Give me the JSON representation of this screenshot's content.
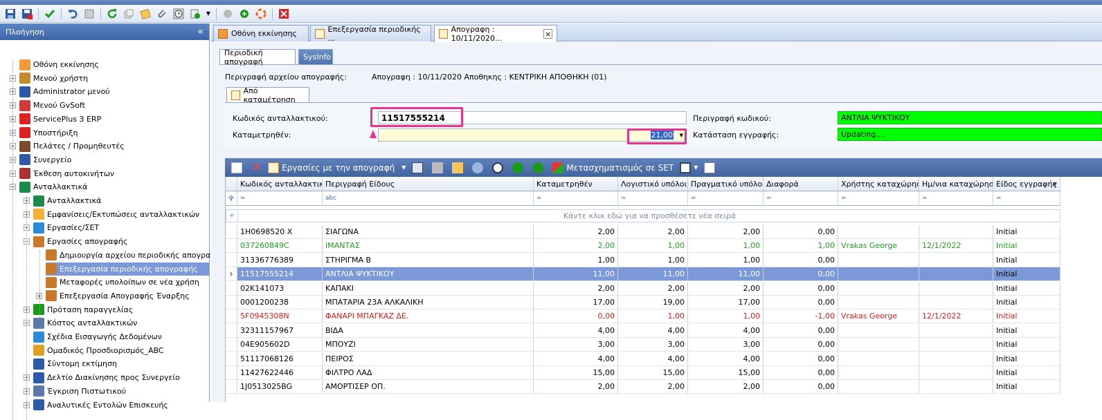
{
  "toolbar": {
    "icons": [
      "save-icon",
      "save-close-icon",
      "check-icon",
      "undo-icon",
      "list-icon",
      "refresh-icon",
      "copy-icon",
      "notes-icon",
      "attach-icon",
      "clock-icon",
      "export-icon",
      "dropdown-icon",
      "disabled-circle-icon",
      "green-circle-icon",
      "help-ring-icon",
      "close-red-icon"
    ]
  },
  "nav": {
    "title": "Πλοήγηση",
    "collapse": "«",
    "items": [
      {
        "label": "Οθόνη εκκίνησης",
        "level": 1
      },
      {
        "label": "Μενού χρήστη",
        "level": 1
      },
      {
        "label": "Administrator μενού",
        "level": 1
      },
      {
        "label": "Μενού GvSoft",
        "level": 1
      },
      {
        "label": "ServicePlus 3 ERP",
        "level": 1
      },
      {
        "label": "Υποστήριξη",
        "level": 1
      },
      {
        "label": "Πελάτες / Προμηθευτές",
        "level": 1
      },
      {
        "label": "Συνεργείο",
        "level": 1
      },
      {
        "label": "Έκθεση αυτοκινήτων",
        "level": 1
      },
      {
        "label": "Ανταλλακτικά",
        "level": 1
      },
      {
        "label": "Ανταλλακτικά",
        "level": 2
      },
      {
        "label": "Εμφανίσεις/Εκτυπώσεις ανταλλακτικών",
        "level": 2
      },
      {
        "label": "Εργασίες/ΣΕΤ",
        "level": 2
      },
      {
        "label": "Εργασίες απογραφής",
        "level": 2
      },
      {
        "label": "Δημιουργία αρχείου περιοδικής απογραφής",
        "level": 3
      },
      {
        "label": "Επεξεργασία περιοδικής απογραφής",
        "level": 3
      },
      {
        "label": "Μεταφορές υπολοίπων σε νέα χρήση",
        "level": 3
      },
      {
        "label": "Επεξεργασία Απογραφής Έναρξης",
        "level": 3
      },
      {
        "label": "Πρόταση παραγγελίας",
        "level": 2
      },
      {
        "label": "Κόστος ανταλλακτικών",
        "level": 2
      },
      {
        "label": "Σχέδια Εισαγωγής Δεδομένων",
        "level": 2
      },
      {
        "label": "Ομαδικός Προσδιορισμός_ABC",
        "level": 2
      },
      {
        "label": "Σύντομη εκτίμηση",
        "level": 2
      },
      {
        "label": "Δελτίο Διακίνησης προς Συνεργείο",
        "level": 2
      },
      {
        "label": "Έγκριση Πιστωτικού",
        "level": 2
      },
      {
        "label": "Αναλυτικές Εντολών Επισκευής",
        "level": 2
      }
    ]
  },
  "tabs": [
    {
      "label": "Οθόνη εκκίνησης"
    },
    {
      "label": "Επεξεργασία περιοδικής ..."
    },
    {
      "label": "Απογραφη : 10/11/2020..."
    }
  ],
  "tab_close": "×",
  "subtabs": [
    "Περιοδική απογραφή",
    "SysInfo"
  ],
  "form": {
    "file_desc_label": "Περιγραφή αρχείου απογραφής:",
    "file_desc_value": "Απογραφη : 10/11/2020   Αποθηκης : ΚΕΝΤΡΙΚΗ ΑΠΟΘΗΚΗ (01)",
    "group_title": "Από καταμέτρηση",
    "code_label": "Κωδικός ανταλλακτικού:",
    "code_value": "11517555214",
    "counted_label": "Καταμετρηθέν:",
    "counted_value": "21,00",
    "code_desc_label": "Περιγραφή κωδικού:",
    "code_desc_value": "ΑΝΤΛΙΑ ΨΥΚΤΙΚΟΥ",
    "status_label": "Κατάσταση εγγραφής:",
    "status_value": "Updating....",
    "green": "#00ff00"
  },
  "gridtoolbar": {
    "jobs": "Εργασίες με την απογραφή",
    "transform": "Μετασχηματισμός σε SET"
  },
  "grid": {
    "columns": [
      "Κωδικός ανταλλακτικού",
      "Περιγραφή Είδους",
      "Καταμετρηθέν",
      "Λογιστικό υπόλοιπο",
      "Πραγματικό υπόλοιπο",
      "Διαφορά",
      "Χρήστης καταχώρησης",
      "Ημ/νια καταχώρησης",
      "Είδος εγγραφής"
    ],
    "filter_eq": "=",
    "filter_abc": "abc",
    "newrow": "Κάντε κλικ εδώ για να προσθέσετε νέα σειρά",
    "rows": [
      {
        "code": "1H0698520 X",
        "desc": "ΣΙΑΓΩΝΑ",
        "counted": "2,00",
        "acc": "2,00",
        "real": "2,00",
        "diff": "0,00",
        "user": "",
        "date": "",
        "type": "Initial",
        "style": ""
      },
      {
        "code": "037260849C",
        "desc": "ΙΜΑΝΤΑΣ",
        "counted": "2,00",
        "acc": "1,00",
        "real": "1,00",
        "diff": "1,00",
        "user": "Vrakas George",
        "date": "12/1/2022",
        "type": "Initial",
        "style": "green"
      },
      {
        "code": "31336776389",
        "desc": "ΣΤΗΡΙΓΜΑ Β",
        "counted": "1,00",
        "acc": "1,00",
        "real": "1,00",
        "diff": "0,00",
        "user": "",
        "date": "",
        "type": "Initial",
        "style": ""
      },
      {
        "code": "11517555214",
        "desc": "ΑΝΤΛΙΑ ΨΥΚΤΙΚΟΥ",
        "counted": "11,00",
        "acc": "11,00",
        "real": "11,00",
        "diff": "0,00",
        "user": "",
        "date": "",
        "type": "Initial",
        "style": "sel"
      },
      {
        "code": "02K141073",
        "desc": "ΚΑΠΑΚΙ",
        "counted": "2,00",
        "acc": "2,00",
        "real": "2,00",
        "diff": "0,00",
        "user": "",
        "date": "",
        "type": "Initial",
        "style": ""
      },
      {
        "code": "0001200238",
        "desc": "ΜΠΑΤΑΡΙΑ 23Α ΑΛΚΑΛΙΚΗ",
        "counted": "17,00",
        "acc": "19,00",
        "real": "17,00",
        "diff": "0,00",
        "user": "",
        "date": "",
        "type": "Initial",
        "style": ""
      },
      {
        "code": "5F0945308N",
        "desc": "ΦΑΝΑΡΙ ΜΠΑΓΚΑΖ ΔΕ.",
        "counted": "0,00",
        "acc": "1,00",
        "real": "1,00",
        "diff": "-1,00",
        "user": "Vrakas George",
        "date": "12/1/2022",
        "type": "Initial",
        "style": "red"
      },
      {
        "code": "32311157967",
        "desc": "ΒΙΔΑ",
        "counted": "4,00",
        "acc": "4,00",
        "real": "4,00",
        "diff": "0,00",
        "user": "",
        "date": "",
        "type": "Initial",
        "style": ""
      },
      {
        "code": "04E905602D",
        "desc": "ΜΠΟΥΖΙ",
        "counted": "3,00",
        "acc": "3,00",
        "real": "3,00",
        "diff": "0,00",
        "user": "",
        "date": "",
        "type": "Initial",
        "style": ""
      },
      {
        "code": "51117068126",
        "desc": "ΠΕΙΡΟΣ",
        "counted": "4,00",
        "acc": "4,00",
        "real": "4,00",
        "diff": "0,00",
        "user": "",
        "date": "",
        "type": "Initial",
        "style": ""
      },
      {
        "code": "11427622446",
        "desc": "ΦΙΛΤΡΟ ΛΑΔ",
        "counted": "15,00",
        "acc": "15,00",
        "real": "15,00",
        "diff": "0,00",
        "user": "",
        "date": "",
        "type": "Initial",
        "style": ""
      },
      {
        "code": "1J0513025BG",
        "desc": "ΑΜΟΡΤΙΣΕΡ ΟΠ.",
        "counted": "2,00",
        "acc": "2,00",
        "real": "2,00",
        "diff": "0,00",
        "user": "",
        "date": "",
        "type": "Initial",
        "style": ""
      }
    ]
  }
}
